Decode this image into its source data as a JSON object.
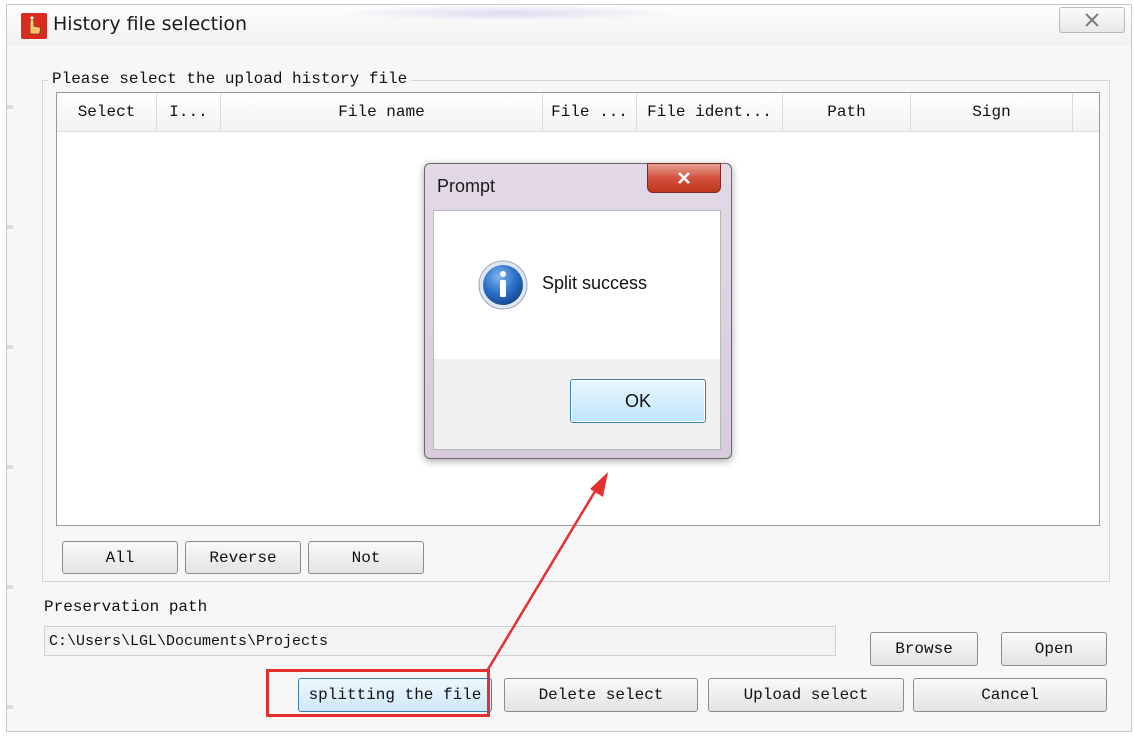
{
  "window": {
    "title": "History file selection"
  },
  "group": {
    "label": "Please select the upload history file"
  },
  "grid": {
    "columns": [
      "Select",
      "I...",
      "File name",
      "File ...",
      "File ident...",
      "Path",
      "Sign"
    ]
  },
  "selection_buttons": {
    "all": "All",
    "reverse": "Reverse",
    "not": "Not"
  },
  "preservation": {
    "label": "Preservation path",
    "value": "C:\\Users\\LGL\\Documents\\Projects",
    "browse": "Browse",
    "open": "Open"
  },
  "actions": {
    "split": "splitting the file",
    "delete": "Delete select",
    "upload": "Upload select",
    "cancel": "Cancel"
  },
  "dialog": {
    "title": "Prompt",
    "message": "Split success",
    "ok": "OK",
    "icon": "info-icon"
  },
  "colors": {
    "highlight": "#e53030",
    "dialog_close": "#c94a36",
    "ok_button": "#bee6fd"
  }
}
